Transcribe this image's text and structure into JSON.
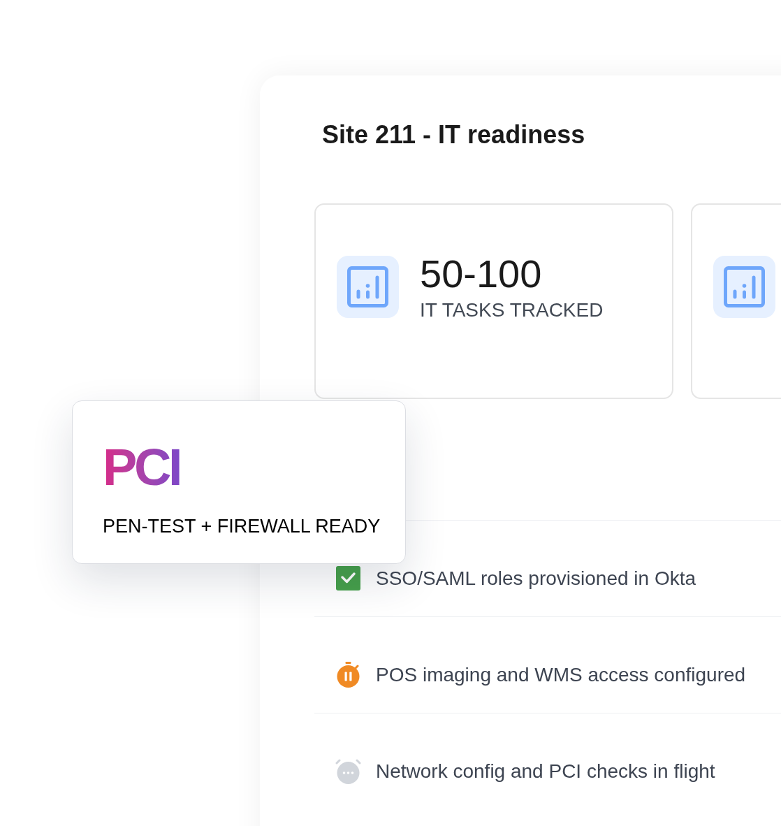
{
  "title": "Site 211 - IT readiness",
  "stat_cards": [
    {
      "kind": "full",
      "value": "50-100",
      "label": "IT TASKS TRACKED"
    },
    {
      "kind": "cut_off"
    }
  ],
  "checklist": [
    {
      "kind": "done",
      "text": "SSO/SAML roles provisioned in Okta"
    },
    {
      "kind": "paused",
      "text": "POS imaging and WMS access configured"
    },
    {
      "kind": "waiting",
      "text": "Network config and PCI checks in flight"
    }
  ],
  "badge_card": {
    "title": "PCI",
    "caption": "PEN-TEST + FIREWALL READY"
  }
}
